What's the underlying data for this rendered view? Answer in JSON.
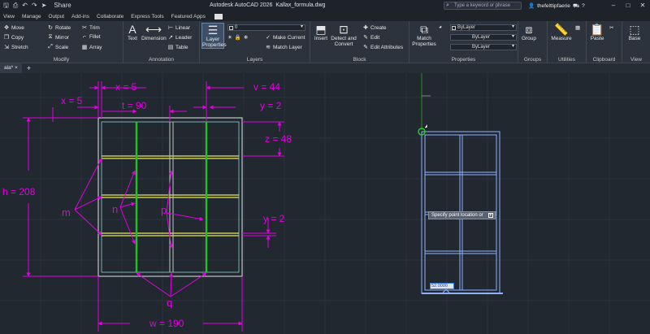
{
  "titlebar": {
    "share_label": "Share",
    "app_title": "Autodesk AutoCAD 2026",
    "file_name": "Kallax_formula.dwg",
    "search_placeholder": "Type a keyword or phrase",
    "username": "thefelttipfaerie"
  },
  "menu": [
    "View",
    "Manage",
    "Output",
    "Add-ins",
    "Collaborate",
    "Express Tools",
    "Featured Apps"
  ],
  "ribbon": {
    "modify": {
      "title": "Modify",
      "items": [
        "Move",
        "Rotate",
        "Trim",
        "Copy",
        "Mirror",
        "Fillet",
        "Stretch",
        "Scale",
        "Array"
      ]
    },
    "annotation": {
      "title": "Annotation",
      "text": "Text",
      "dimension": "Dimension",
      "linear": "Linear",
      "leader": "Leader",
      "table": "Table"
    },
    "layers": {
      "title": "Layers",
      "layer_properties": "Layer Properties",
      "layer_value": "0",
      "make_current": "Make Current",
      "match_layer": "Match Layer"
    },
    "block": {
      "title": "Block",
      "insert": "Insert",
      "detect": "Detect and Convert",
      "create": "Create",
      "edit": "Edit",
      "edit_attributes": "Edit Attributes"
    },
    "properties": {
      "title": "Properties",
      "match": "Match Properties",
      "bylayer1": "ByLayer",
      "bylayer2": "ByLayer",
      "bylayer3": "ByLayer"
    },
    "groups": {
      "title": "Groups",
      "group": "Group"
    },
    "utilities": {
      "title": "Utilities",
      "measure": "Measure"
    },
    "clipboard": {
      "title": "Clipboard",
      "paste": "Paste"
    },
    "view": {
      "title": "View",
      "base": "Base"
    }
  },
  "tabs": {
    "file_tab": "ala*"
  },
  "drawing": {
    "dims": {
      "x5_top": "x = 5",
      "x5_left": "x = 5",
      "t90": "t = 90",
      "v44": "v = 44",
      "y2_top": "y = 2",
      "z48": "z = 48",
      "h208": "h = 208",
      "y2_right": "y = 2",
      "w190": "w = 190"
    },
    "labels": {
      "m": "m",
      "n": "n",
      "p": "p",
      "q": "q"
    }
  },
  "prompt": {
    "tooltip": "Specify point location or",
    "dyn_value": "52.0000"
  },
  "colors": {
    "magenta": "#e400e4",
    "green": "#22c022",
    "yellow": "#c8c850",
    "cyan_grid": "#8fd0d0",
    "blue_ghost": "#8fb2ff"
  }
}
